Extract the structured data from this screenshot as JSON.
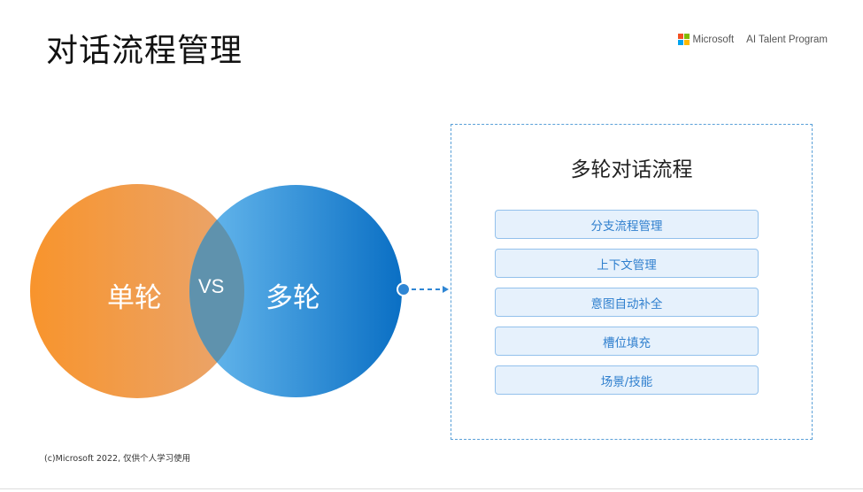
{
  "slide": {
    "title": "对话流程管理",
    "footer": "(c)Microsoft 2022, 仅供个人学习使用"
  },
  "brand": {
    "microsoft": "Microsoft",
    "program": "AI Talent Program",
    "logo_colors": [
      "#f25022",
      "#7fba00",
      "#00a4ef",
      "#ffb900"
    ]
  },
  "venn": {
    "left_label": "单轮",
    "right_label": "多轮",
    "vs_label": "VS",
    "colors": {
      "left_start": "#f8952f",
      "left_end": "#e8a06a",
      "right_start": "#6ab9ee",
      "right_end": "#0b72c7",
      "overlap": "#5f94b0"
    }
  },
  "panel": {
    "title": "多轮对话流程",
    "items": [
      "分支流程管理",
      "上下文管理",
      "意图自动补全",
      "槽位填充",
      "场景/技能"
    ]
  }
}
